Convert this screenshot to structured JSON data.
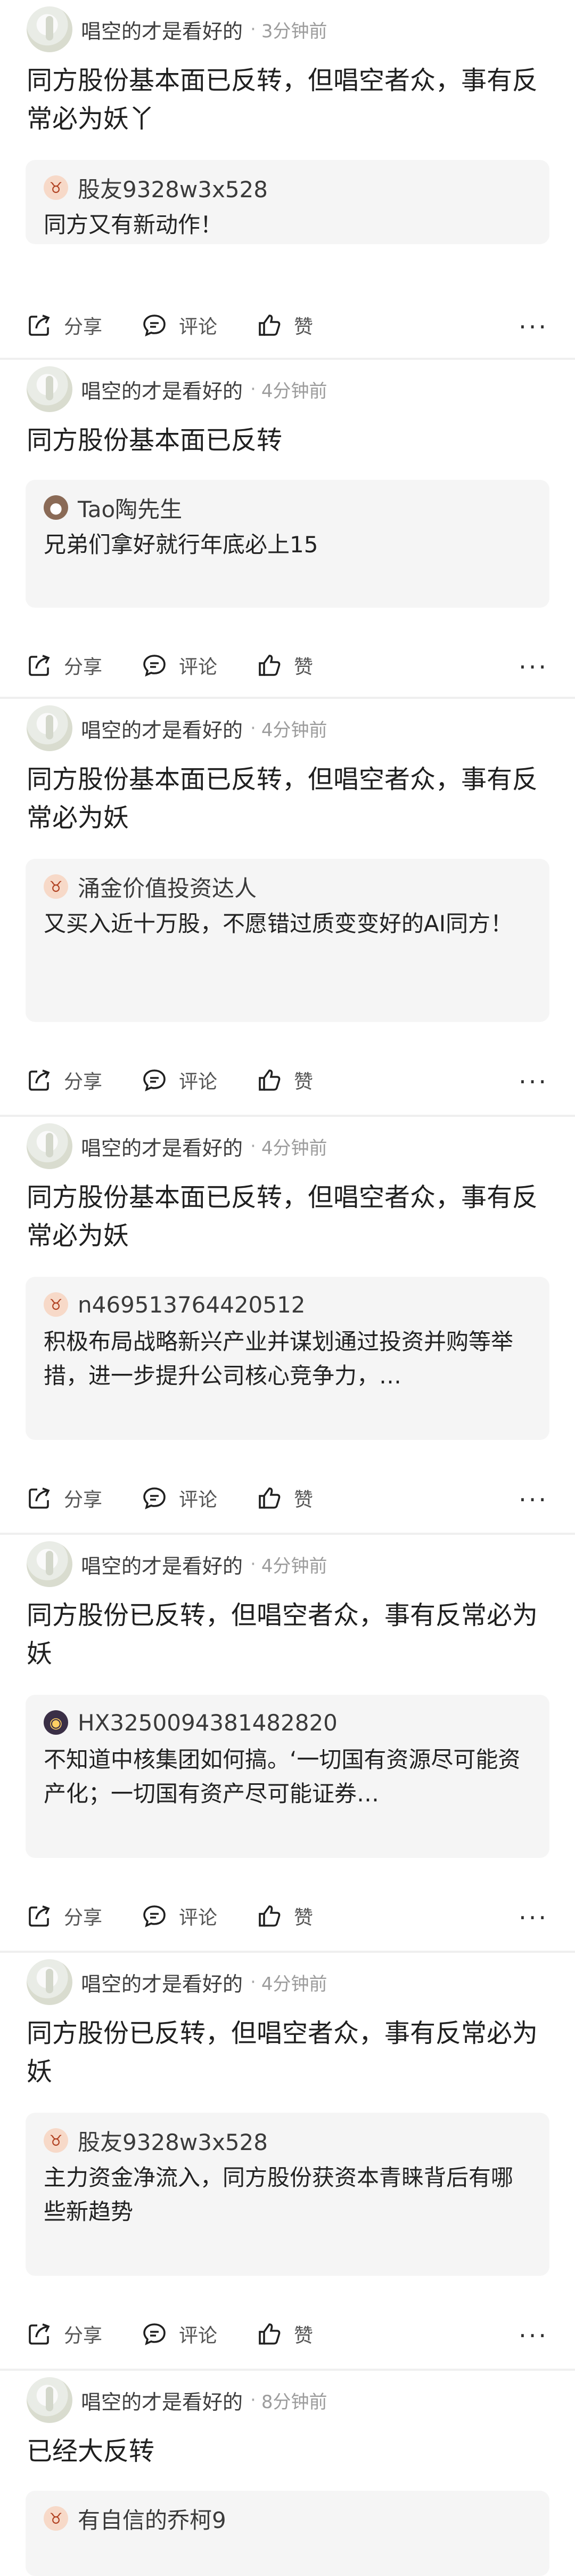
{
  "actions": {
    "share_label": "分享",
    "comment_label": "评论",
    "like_label": "赞",
    "more_label": "···"
  },
  "posts": [
    {
      "user": "唱空的才是看好的",
      "time": "3分钟前",
      "text": "同方股份基本面已反转，但唱空者众，事有反常必为妖丫",
      "quote": {
        "user": "股友9328w3x528",
        "text": "同方又有新动作！"
      }
    },
    {
      "user": "唱空的才是看好的",
      "time": "4分钟前",
      "text": "同方股份基本面已反转",
      "quote": {
        "user": "Tao陶先生",
        "text": "兄弟们拿好就行年底必上15"
      }
    },
    {
      "user": "唱空的才是看好的",
      "time": "4分钟前",
      "text": "同方股份基本面已反转，但唱空者众，事有反常必为妖",
      "quote": {
        "user": "涌金价值投资达人",
        "text": "又买入近十万股，不愿错过质变变好的AI同方！"
      }
    },
    {
      "user": "唱空的才是看好的",
      "time": "4分钟前",
      "text": "同方股份基本面已反转，但唱空者众，事有反常必为妖",
      "quote": {
        "user": "n469513764420512",
        "text": "积极布局战略新兴产业并谋划通过投资并购等举措，进一步提升公司核心竞争力，…"
      }
    },
    {
      "user": "唱空的才是看好的",
      "time": "4分钟前",
      "text": "同方股份已反转，但唱空者众，事有反常必为妖",
      "quote": {
        "user": "HX3250094381482820",
        "text": "不知道中核集团如何搞。‘一切国有资源尽可能资产化；一切国有资产尽可能证券…"
      }
    },
    {
      "user": "唱空的才是看好的",
      "time": "4分钟前",
      "text": "同方股份已反转，但唱空者众，事有反常必为妖",
      "quote": {
        "user": "股友9328w3x528",
        "text": "主力资金净流入，同方股份获资本青睐背后有哪些新趋势"
      }
    },
    {
      "user": "唱空的才是看好的",
      "time": "8分钟前",
      "text": "已经大反转",
      "quote": {
        "user": "有自信的乔柯9",
        "text": ""
      }
    }
  ]
}
